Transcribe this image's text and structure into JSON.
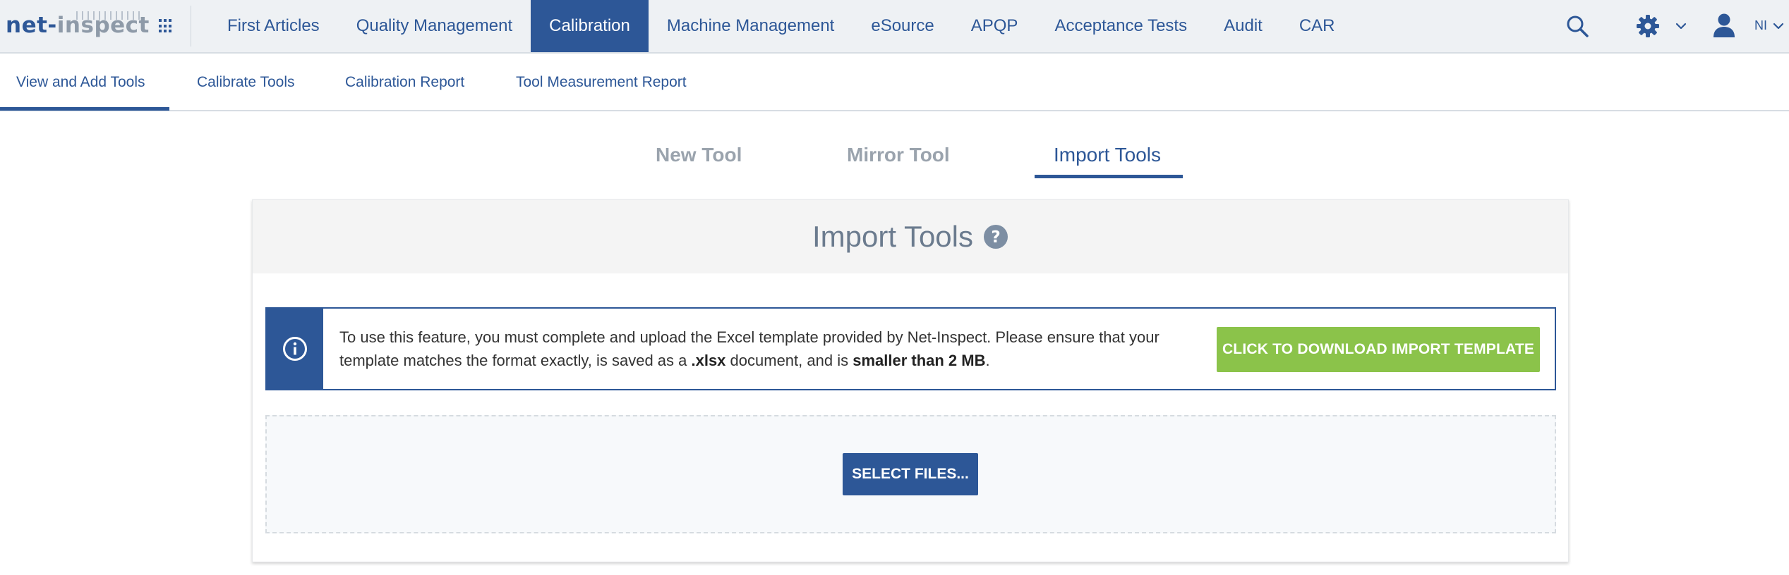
{
  "logo": {
    "part1": "net",
    "part2": "-",
    "part3": "inspect"
  },
  "nav": {
    "items": [
      {
        "label": "First Articles"
      },
      {
        "label": "Quality Management"
      },
      {
        "label": "Calibration"
      },
      {
        "label": "Machine Management"
      },
      {
        "label": "eSource"
      },
      {
        "label": "APQP"
      },
      {
        "label": "Acceptance Tests"
      },
      {
        "label": "Audit"
      },
      {
        "label": "CAR"
      }
    ],
    "active_index": 2,
    "user_initials": "NI",
    "icons": [
      "apps-grid-icon",
      "search-icon",
      "gear-icon",
      "chevron-down-icon",
      "user-icon"
    ]
  },
  "subnav": {
    "tabs": [
      {
        "label": "View and Add Tools"
      },
      {
        "label": "Calibrate Tools"
      },
      {
        "label": "Calibration Report"
      },
      {
        "label": "Tool Measurement Report"
      }
    ],
    "active_index": 0
  },
  "content_tabs": {
    "tabs": [
      {
        "label": "New Tool"
      },
      {
        "label": "Mirror Tool"
      },
      {
        "label": "Import Tools"
      }
    ],
    "active_index": 2
  },
  "panel": {
    "title": "Import Tools",
    "info": {
      "text_a": "To use this feature, you must complete and upload the Excel template provided by Net-Inspect. Please ensure that your template matches the format exactly, is saved as a ",
      "text_b": ".xlsx",
      "text_c": " document, and is ",
      "text_d": "smaller than 2 MB",
      "text_e": "."
    },
    "download_button": "CLICK TO DOWNLOAD IMPORT TEMPLATE",
    "select_button": "SELECT FILES..."
  },
  "colors": {
    "primary": "#2d5797",
    "success": "#8bc34a",
    "muted_tab": "#9aa3ad",
    "nav_bg": "#eef1f4"
  }
}
